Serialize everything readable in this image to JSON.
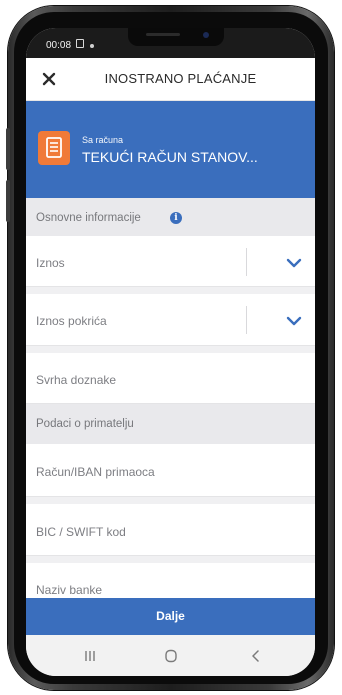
{
  "status_bar": {
    "time": "00:08"
  },
  "header": {
    "title": "INOSTRANO PLAĆANJE",
    "close_icon": "close-icon"
  },
  "account": {
    "label": "Sa računa",
    "name": "TEKUĆI RAČUN STANOV...",
    "icon": "document-icon",
    "icon_color": "#f07a38"
  },
  "form": {
    "basic_section": {
      "title": "Osnovne informacije",
      "info_icon_glyph": "i"
    },
    "amount_label": "Iznos",
    "cover_amount_label": "Iznos pokrića",
    "purpose_label": "Svrha doznake",
    "recipient_section": {
      "title": "Podaci o primatelju"
    },
    "iban_label": "Račun/IBAN primaoca",
    "bic_label": "BIC / SWIFT kod",
    "bank_name_label": "Naziv banke"
  },
  "actions": {
    "next_label": "Dalje"
  },
  "nav": {
    "recents": "|||",
    "home": "○",
    "back": "‹"
  },
  "colors": {
    "primary": "#3a6ebd",
    "accent": "#f07a38",
    "section_bg": "#e9e9ec",
    "label_text": "#7d7e83"
  }
}
